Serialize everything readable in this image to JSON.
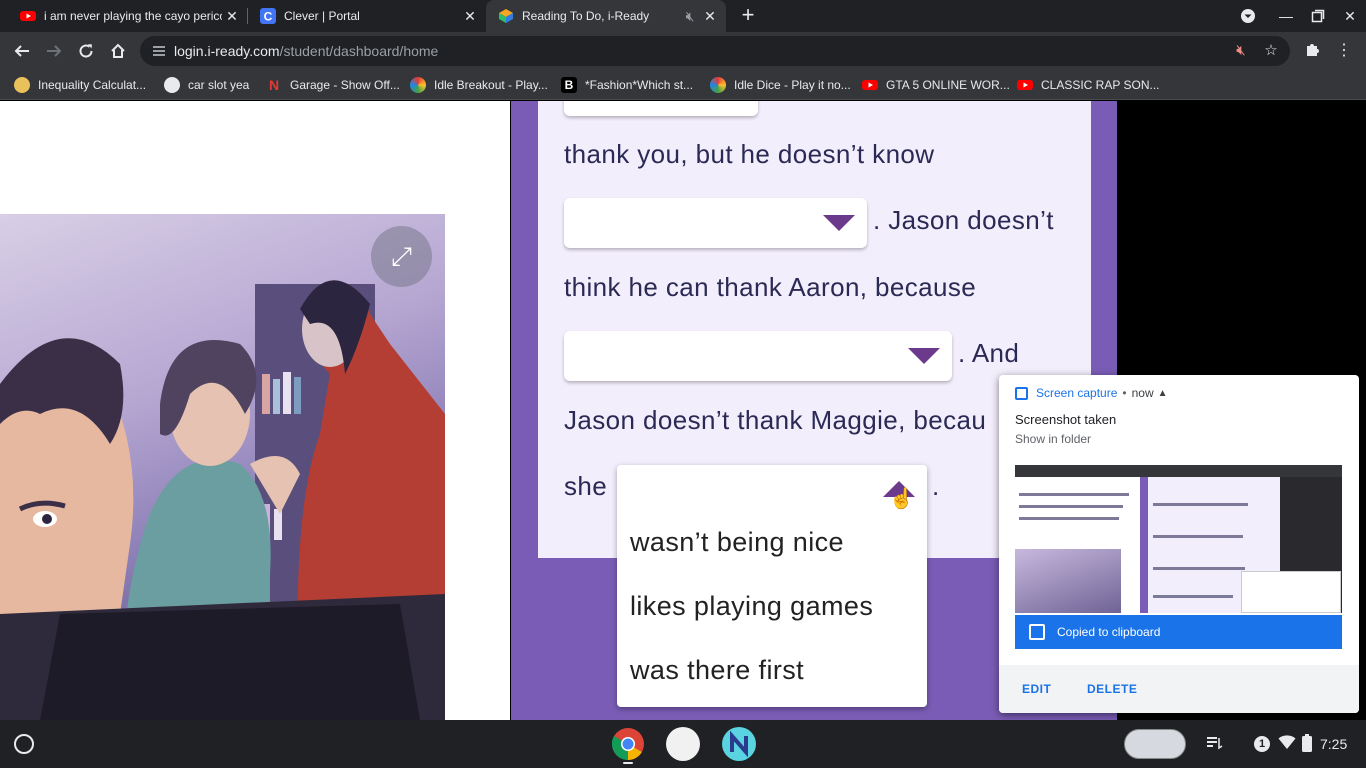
{
  "browser": {
    "tabs": [
      {
        "title": "i am never playing the cayo perico"
      },
      {
        "title": "Clever | Portal"
      },
      {
        "title": "Reading To Do, i-Ready"
      }
    ],
    "url_host": "login.i-ready.com",
    "url_path": "/student/dashboard/home",
    "bookmarks": [
      {
        "label": "Inequality Calculat..."
      },
      {
        "label": "car slot yea"
      },
      {
        "label": "Garage - Show Off..."
      },
      {
        "label": "Idle Breakout - Play..."
      },
      {
        "label": "*Fashion*Which st..."
      },
      {
        "label": "Idle Dice - Play it no..."
      },
      {
        "label": "GTA 5 ONLINE WOR..."
      },
      {
        "label": "CLASSIC RAP SON..."
      }
    ]
  },
  "lesson": {
    "line1": "thank you, but he doesn’t know",
    "line2": ". Jason doesn’t",
    "line3": "think he can thank Aaron, because",
    "line4": ". And",
    "line5": "Jason doesn’t thank Maggie, becau",
    "line6_prefix": "she",
    "line6_suffix": ".",
    "options": [
      "wasn’t being nice",
      "likes playing games",
      "was there first"
    ]
  },
  "notification": {
    "app": "Screen capture",
    "time": "now",
    "title": "Screenshot taken",
    "subtitle": "Show in folder",
    "banner": "Copied to clipboard",
    "edit": "EDIT",
    "delete": "DELETE"
  },
  "shelf": {
    "tray_badge": "1",
    "clock": "7:25"
  },
  "colors": {
    "accent": "#1a73e8",
    "lesson_purple": "#7a5cb6",
    "caret": "#6b3a8c",
    "text_navy": "#2b2a55"
  }
}
